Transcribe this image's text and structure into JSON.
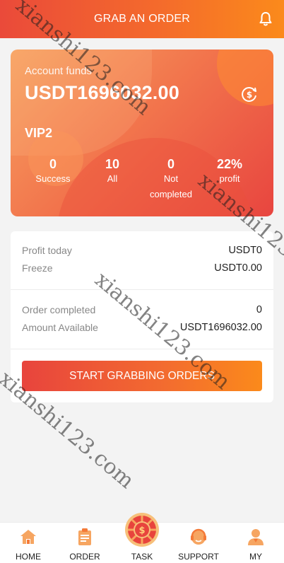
{
  "header": {
    "title": "GRAB AN ORDER",
    "bell_icon": "bell-icon"
  },
  "funds": {
    "label": "Account funds",
    "value": "USDT1696032.00",
    "coin_icon": "dollar-refresh-icon",
    "vip": "VIP2"
  },
  "stats": [
    {
      "num": "0",
      "label": "Success"
    },
    {
      "num": "10",
      "label": "All"
    },
    {
      "num": "0",
      "label": "Not completed"
    },
    {
      "num": "22%",
      "label": "profit"
    }
  ],
  "details": {
    "profit_today": {
      "label": "Profit today",
      "value": "USDT0"
    },
    "freeze": {
      "label": "Freeze",
      "value": "USDT0.00"
    },
    "order_completed": {
      "label": "Order completed",
      "value": "0"
    },
    "amount_available": {
      "label": "Amount Available",
      "value": "USDT1696032.00"
    }
  },
  "grab_button": "START GRABBING ORDERS",
  "nav": [
    {
      "label": "HOME",
      "icon": "home-icon"
    },
    {
      "label": "ORDER",
      "icon": "clipboard-icon"
    },
    {
      "label": "TASK",
      "icon": "wheel-icon"
    },
    {
      "label": "SUPPORT",
      "icon": "headset-icon"
    },
    {
      "label": "MY",
      "icon": "user-icon"
    }
  ],
  "watermark": "xianshi123.com",
  "colors": {
    "accent": "#f36c2f",
    "accent_red": "#e8443d",
    "accent_orange": "#fb8a1b"
  }
}
